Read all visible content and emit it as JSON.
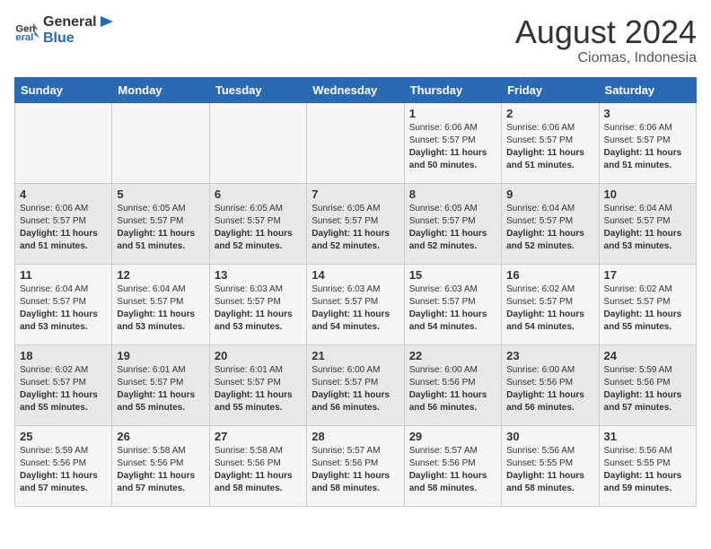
{
  "header": {
    "logo_line1": "General",
    "logo_line2": "Blue",
    "month_year": "August 2024",
    "location": "Ciomas, Indonesia"
  },
  "weekdays": [
    "Sunday",
    "Monday",
    "Tuesday",
    "Wednesday",
    "Thursday",
    "Friday",
    "Saturday"
  ],
  "weeks": [
    [
      {
        "day": "",
        "info": ""
      },
      {
        "day": "",
        "info": ""
      },
      {
        "day": "",
        "info": ""
      },
      {
        "day": "",
        "info": ""
      },
      {
        "day": "1",
        "info": "Sunrise: 6:06 AM\nSunset: 5:57 PM\nDaylight: 11 hours and 50 minutes."
      },
      {
        "day": "2",
        "info": "Sunrise: 6:06 AM\nSunset: 5:57 PM\nDaylight: 11 hours and 51 minutes."
      },
      {
        "day": "3",
        "info": "Sunrise: 6:06 AM\nSunset: 5:57 PM\nDaylight: 11 hours and 51 minutes."
      }
    ],
    [
      {
        "day": "4",
        "info": "Sunrise: 6:06 AM\nSunset: 5:57 PM\nDaylight: 11 hours and 51 minutes."
      },
      {
        "day": "5",
        "info": "Sunrise: 6:05 AM\nSunset: 5:57 PM\nDaylight: 11 hours and 51 minutes."
      },
      {
        "day": "6",
        "info": "Sunrise: 6:05 AM\nSunset: 5:57 PM\nDaylight: 11 hours and 52 minutes."
      },
      {
        "day": "7",
        "info": "Sunrise: 6:05 AM\nSunset: 5:57 PM\nDaylight: 11 hours and 52 minutes."
      },
      {
        "day": "8",
        "info": "Sunrise: 6:05 AM\nSunset: 5:57 PM\nDaylight: 11 hours and 52 minutes."
      },
      {
        "day": "9",
        "info": "Sunrise: 6:04 AM\nSunset: 5:57 PM\nDaylight: 11 hours and 52 minutes."
      },
      {
        "day": "10",
        "info": "Sunrise: 6:04 AM\nSunset: 5:57 PM\nDaylight: 11 hours and 53 minutes."
      }
    ],
    [
      {
        "day": "11",
        "info": "Sunrise: 6:04 AM\nSunset: 5:57 PM\nDaylight: 11 hours and 53 minutes."
      },
      {
        "day": "12",
        "info": "Sunrise: 6:04 AM\nSunset: 5:57 PM\nDaylight: 11 hours and 53 minutes."
      },
      {
        "day": "13",
        "info": "Sunrise: 6:03 AM\nSunset: 5:57 PM\nDaylight: 11 hours and 53 minutes."
      },
      {
        "day": "14",
        "info": "Sunrise: 6:03 AM\nSunset: 5:57 PM\nDaylight: 11 hours and 54 minutes."
      },
      {
        "day": "15",
        "info": "Sunrise: 6:03 AM\nSunset: 5:57 PM\nDaylight: 11 hours and 54 minutes."
      },
      {
        "day": "16",
        "info": "Sunrise: 6:02 AM\nSunset: 5:57 PM\nDaylight: 11 hours and 54 minutes."
      },
      {
        "day": "17",
        "info": "Sunrise: 6:02 AM\nSunset: 5:57 PM\nDaylight: 11 hours and 55 minutes."
      }
    ],
    [
      {
        "day": "18",
        "info": "Sunrise: 6:02 AM\nSunset: 5:57 PM\nDaylight: 11 hours and 55 minutes."
      },
      {
        "day": "19",
        "info": "Sunrise: 6:01 AM\nSunset: 5:57 PM\nDaylight: 11 hours and 55 minutes."
      },
      {
        "day": "20",
        "info": "Sunrise: 6:01 AM\nSunset: 5:57 PM\nDaylight: 11 hours and 55 minutes."
      },
      {
        "day": "21",
        "info": "Sunrise: 6:00 AM\nSunset: 5:57 PM\nDaylight: 11 hours and 56 minutes."
      },
      {
        "day": "22",
        "info": "Sunrise: 6:00 AM\nSunset: 5:56 PM\nDaylight: 11 hours and 56 minutes."
      },
      {
        "day": "23",
        "info": "Sunrise: 6:00 AM\nSunset: 5:56 PM\nDaylight: 11 hours and 56 minutes."
      },
      {
        "day": "24",
        "info": "Sunrise: 5:59 AM\nSunset: 5:56 PM\nDaylight: 11 hours and 57 minutes."
      }
    ],
    [
      {
        "day": "25",
        "info": "Sunrise: 5:59 AM\nSunset: 5:56 PM\nDaylight: 11 hours and 57 minutes."
      },
      {
        "day": "26",
        "info": "Sunrise: 5:58 AM\nSunset: 5:56 PM\nDaylight: 11 hours and 57 minutes."
      },
      {
        "day": "27",
        "info": "Sunrise: 5:58 AM\nSunset: 5:56 PM\nDaylight: 11 hours and 58 minutes."
      },
      {
        "day": "28",
        "info": "Sunrise: 5:57 AM\nSunset: 5:56 PM\nDaylight: 11 hours and 58 minutes."
      },
      {
        "day": "29",
        "info": "Sunrise: 5:57 AM\nSunset: 5:56 PM\nDaylight: 11 hours and 58 minutes."
      },
      {
        "day": "30",
        "info": "Sunrise: 5:56 AM\nSunset: 5:55 PM\nDaylight: 11 hours and 58 minutes."
      },
      {
        "day": "31",
        "info": "Sunrise: 5:56 AM\nSunset: 5:55 PM\nDaylight: 11 hours and 59 minutes."
      }
    ]
  ]
}
